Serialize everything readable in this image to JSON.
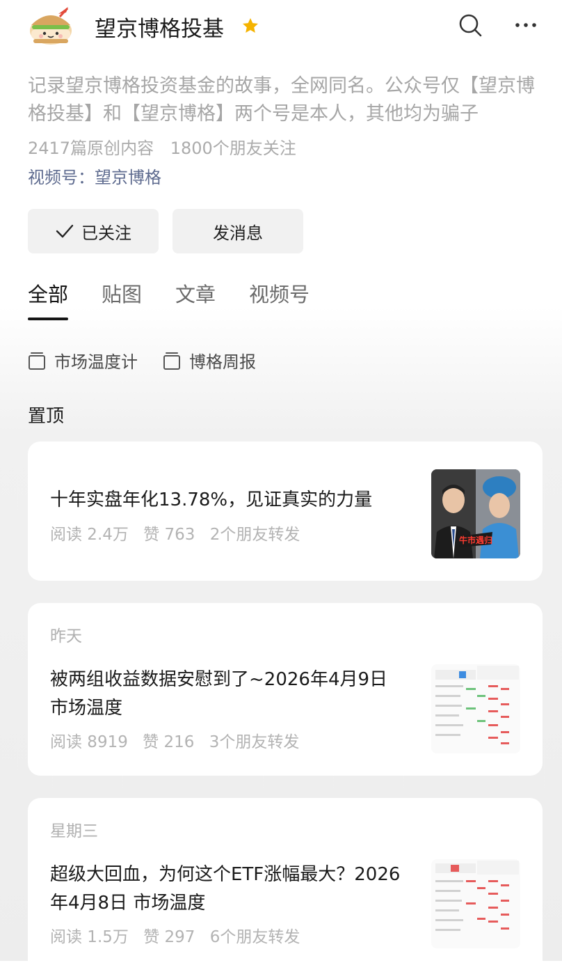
{
  "account": {
    "name": "望京博格投基",
    "description": "记录望京博格投资基金的故事，全网同名。公众号仅【望京博格投基】和【望京博格】两个号是本人，其他均为骗子",
    "articles_count": "2417篇原创内容",
    "followers_count": "1800个朋友关注",
    "video_channel": "视频号：望京博格"
  },
  "actions": {
    "follow_label": "已关注",
    "message_label": "发消息"
  },
  "tabs": [
    {
      "label": "全部",
      "active": true
    },
    {
      "label": "贴图",
      "active": false
    },
    {
      "label": "文章",
      "active": false
    },
    {
      "label": "视频号",
      "active": false
    }
  ],
  "collections": [
    {
      "label": "市场温度计",
      "icon": "collection-icon"
    },
    {
      "label": "博格周报",
      "icon": "collection-icon"
    }
  ],
  "section_title": "置顶",
  "articles": [
    {
      "title": "十年实盘年化13.78%，见证真实的力量",
      "reads": "阅读 2.4万",
      "likes": "赞 763",
      "shares": "2个朋友转发",
      "thumb_text": "牛市遇归"
    },
    {
      "date": "昨天",
      "title": "被两组收益数据安慰到了~2026年4月9日 市场温度",
      "reads": "阅读 8919",
      "likes": "赞 216",
      "shares": "3个朋友转发"
    },
    {
      "date": "星期三",
      "title": "超级大回血，为何这个ETF涨幅最大？2026年4月8日 市场温度",
      "reads": "阅读 1.5万",
      "likes": "赞 297",
      "shares": "6个朋友转发"
    }
  ],
  "colors": {
    "star": "#f5b300",
    "link": "#5e6b8f",
    "muted": "#a6a6a6",
    "button_bg": "#f1f1f1"
  }
}
